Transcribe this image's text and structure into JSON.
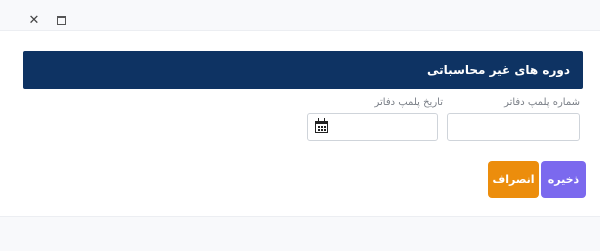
{
  "window": {
    "close_icon": "close-icon",
    "maximize_icon": "maximize-icon"
  },
  "header": {
    "title": "دوره های غیر محاسباتی",
    "background": "#0e3363"
  },
  "form": {
    "ledger_seal_number": {
      "label": "شماره پلمپ دفاتر",
      "value": ""
    },
    "ledger_seal_date": {
      "label": "تاریخ پلمپ دفاتر",
      "value": "",
      "icon": "calendar-icon"
    }
  },
  "actions": {
    "save_label": "ذخیره",
    "save_color": "#7b69ee",
    "cancel_label": "انصراف",
    "cancel_color": "#ec8d0c"
  }
}
